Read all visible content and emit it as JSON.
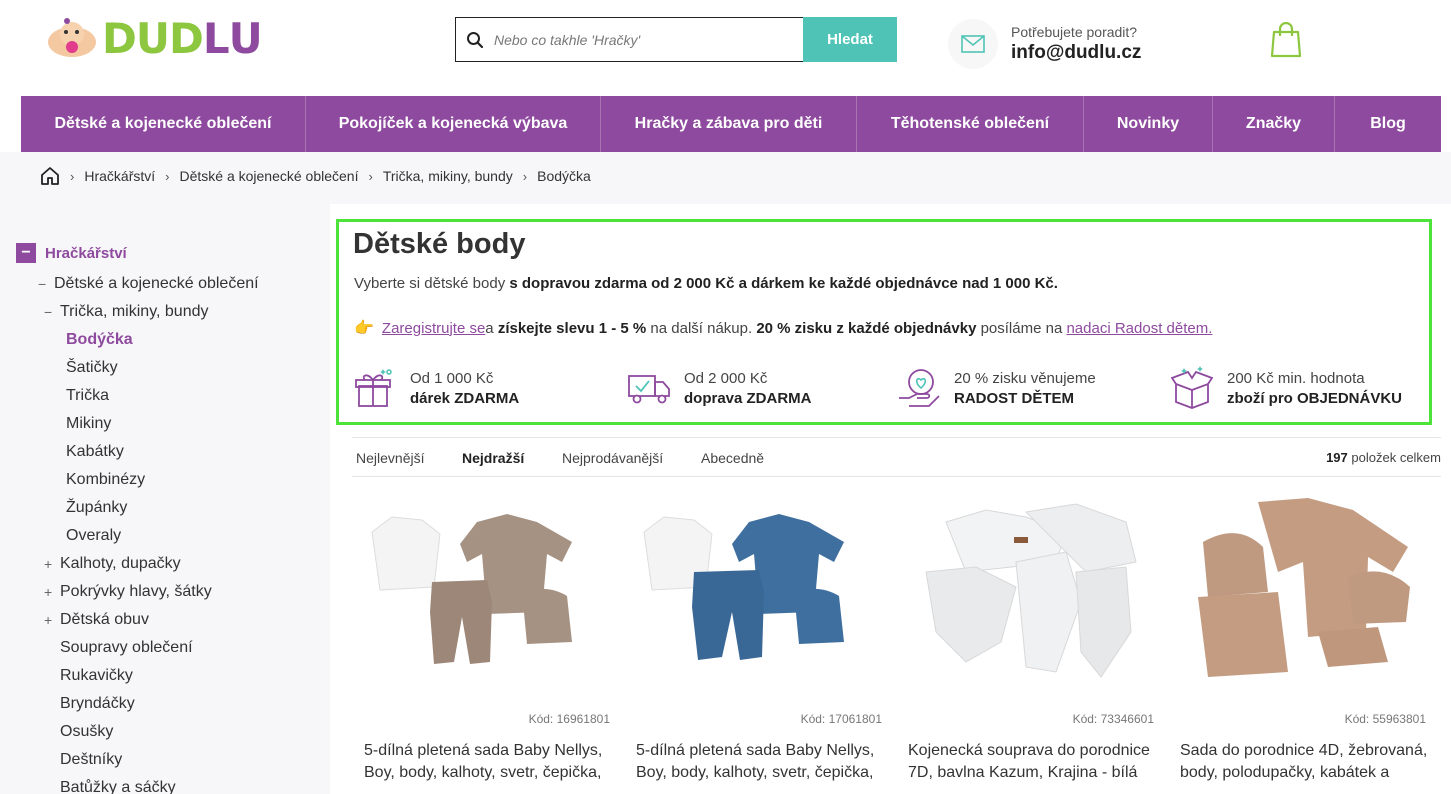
{
  "header": {
    "logo": "DUDLU",
    "search_placeholder": "Nebo co takhle 'Hračky'",
    "search_button": "Hledat",
    "contact_question": "Potřebujete poradit?",
    "contact_email": "info@dudlu.cz"
  },
  "nav": [
    "Dětské a kojenecké oblečení",
    "Pokojíček a kojenecká výbava",
    "Hračky a zábava pro děti",
    "Těhotenské oblečení",
    "Novinky",
    "Značky",
    "Blog"
  ],
  "breadcrumb": [
    "Hračkářství",
    "Dětské a kojenecké oblečení",
    "Trička, mikiny, bundy",
    "Bodýčka"
  ],
  "sidebar": {
    "root": "Hračkářství",
    "items": [
      {
        "mark": "−",
        "label": "Dětské a kojenecké oblečení"
      },
      {
        "mark": "−",
        "label": "Trička, mikiny, bundy"
      },
      {
        "mark": "",
        "label": "Bodýčka"
      },
      {
        "mark": "",
        "label": "Šatičky"
      },
      {
        "mark": "",
        "label": "Trička"
      },
      {
        "mark": "",
        "label": "Mikiny"
      },
      {
        "mark": "",
        "label": "Kabátky"
      },
      {
        "mark": "",
        "label": "Kombinézy"
      },
      {
        "mark": "",
        "label": "Župánky"
      },
      {
        "mark": "",
        "label": "Overaly"
      },
      {
        "mark": "+",
        "label": "Kalhoty, dupačky"
      },
      {
        "mark": "+",
        "label": "Pokrývky hlavy, šátky"
      },
      {
        "mark": "+",
        "label": "Dětská obuv"
      },
      {
        "mark": "",
        "label": "Soupravy oblečení"
      },
      {
        "mark": "",
        "label": "Rukavičky"
      },
      {
        "mark": "",
        "label": "Bryndáčky"
      },
      {
        "mark": "",
        "label": "Osušky"
      },
      {
        "mark": "",
        "label": "Deštníky"
      },
      {
        "mark": "",
        "label": "Batůžky a sáčky"
      }
    ]
  },
  "info": {
    "title": "Dětské body",
    "line1_a": "Vyberte si dětské body ",
    "line1_b": "s dopravou zdarma od 2 000 Kč a dárkem ke každé objednávce nad 1 000 Kč.",
    "line2_link1": "Zaregistrujte se ",
    "line2_a": "a ",
    "line2_b": "získejte slevu 1 - 5 %",
    "line2_c": " na další nákup. ",
    "line2_d": "20 % zisku z každé objednávky",
    "line2_e": " posíláme na ",
    "line2_link2": "nadaci Radost dětem.",
    "features": [
      {
        "icon": "gift-icon",
        "t1": "Od 1 000 Kč",
        "t2": "dárek ZDARMA"
      },
      {
        "icon": "truck-icon",
        "t1": "Od 2 000 Kč",
        "t2": "doprava ZDARMA"
      },
      {
        "icon": "heart-hand-icon",
        "t1": "20 % zisku věnujeme",
        "t2": "RADOST DĚTEM"
      },
      {
        "icon": "box-icon",
        "t1": "200 Kč min. hodnota",
        "t2": "zboží pro OBJEDNÁVKU"
      }
    ]
  },
  "sort": {
    "options": [
      "Nejlevnější",
      "Nejdražší",
      "Nejprodávanější",
      "Abecedně"
    ],
    "active": "Nejdražší",
    "count_num": "197",
    "count_text": " položek celkem"
  },
  "products": [
    {
      "code": "Kód: 16961801",
      "name": "5-dílná pletená sada Baby Nellys, Boy, body, kalhoty, svetr, čepička,",
      "color": "#a69283"
    },
    {
      "code": "Kód: 17061801",
      "name": "5-dílná pletená sada Baby Nellys, Boy, body, kalhoty, svetr, čepička,",
      "color": "#3f6f9e"
    },
    {
      "code": "Kód: 73346601",
      "name": "Kojenecká souprava do porodnice 7D, bavlna Kazum, Krajina - bílá",
      "color": "#e6e8ea"
    },
    {
      "code": "Kód: 55963801",
      "name": "Sada do porodnice 4D, žebrovaná, body, polodupačky, kabátek a",
      "color": "#c49c82"
    }
  ]
}
